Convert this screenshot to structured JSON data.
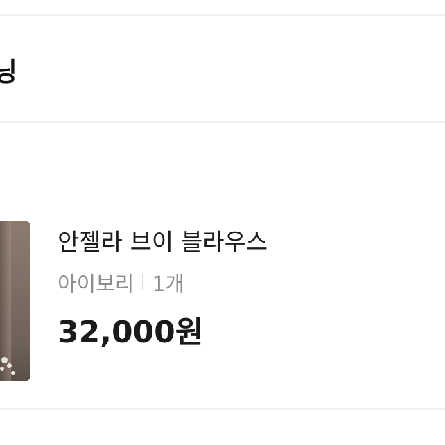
{
  "section": {
    "title": "닝"
  },
  "product": {
    "name": "안젤라 브이 블라우스",
    "color_option": "아이보리",
    "quantity": "1개",
    "price": "32,000원"
  }
}
